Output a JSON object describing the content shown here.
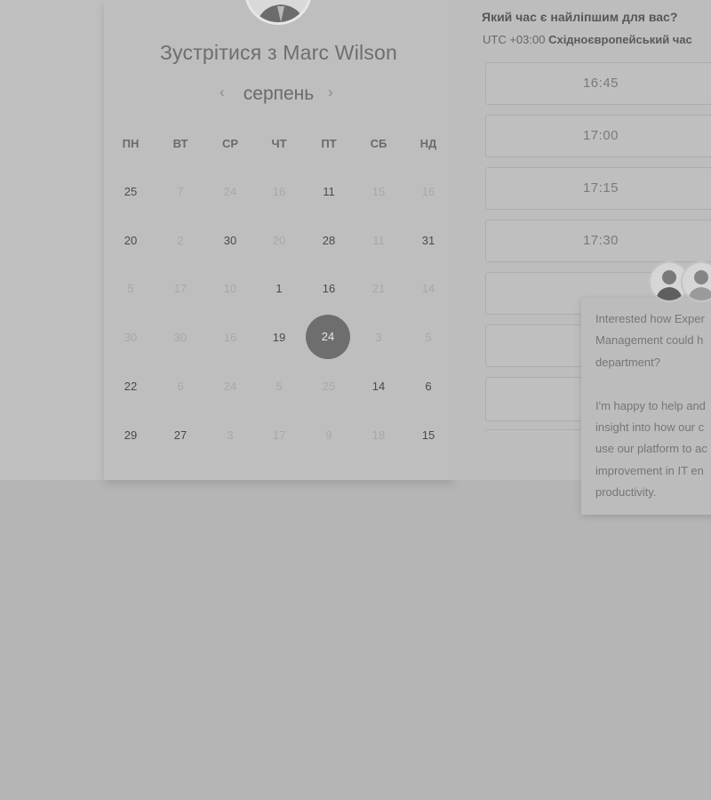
{
  "host": {
    "title": "Зустрітися з Marc Wilson"
  },
  "calendar": {
    "month": "серпень",
    "prev_icon": "chevron-left-icon",
    "next_icon": "chevron-right-icon",
    "weekdays": [
      "ПН",
      "ВТ",
      "СР",
      "ЧТ",
      "ПТ",
      "СБ",
      "НД"
    ],
    "rows": [
      [
        "25",
        "7",
        "24",
        "16",
        "11",
        "15",
        "16"
      ],
      [
        "20",
        "2",
        "30",
        "20",
        "28",
        "11",
        "31"
      ],
      [
        "5",
        "17",
        "10",
        "1",
        "16",
        "21",
        "14"
      ],
      [
        "30",
        "30",
        "16",
        "19",
        "24",
        "3",
        "5"
      ],
      [
        "22",
        "6",
        "24",
        "5",
        "25",
        "14",
        "6"
      ],
      [
        "29",
        "27",
        "3",
        "17",
        "9",
        "18",
        "15"
      ]
    ],
    "selected_day": "24"
  },
  "times": {
    "question": "Який час є найліпшим для вас?",
    "tz_prefix": "UTC +03:00",
    "tz_name": "Східноєвропейський час",
    "slots": [
      "16:45",
      "17:00",
      "17:15",
      "17:30",
      "",
      "",
      ""
    ]
  },
  "chat": {
    "lines": [
      "Interested how Exper",
      "Management could h",
      "department?",
      "",
      "I'm happy to help and",
      "insight into how our c",
      "use our platform to ac",
      "improvement in IT en",
      "productivity."
    ]
  }
}
